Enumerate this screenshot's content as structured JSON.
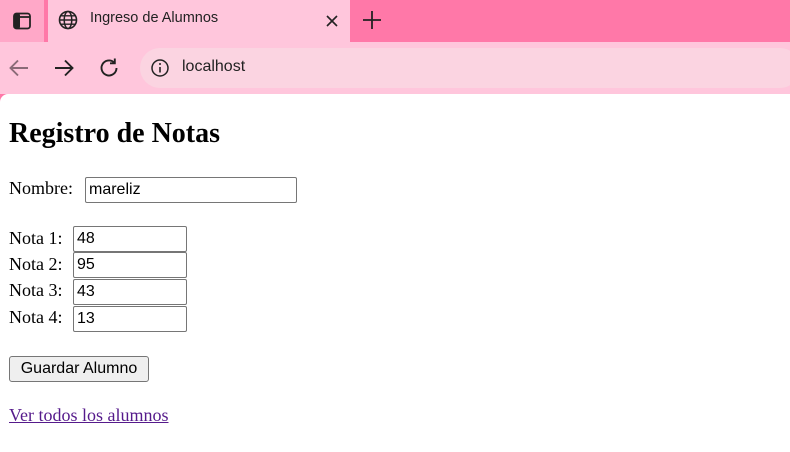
{
  "browser": {
    "tab_title": "Ingreso de Alumnos",
    "url": "localhost",
    "icons": {
      "tab_menu": "tab-menu-icon",
      "favicon": "globe-icon",
      "close": "close-icon",
      "new_tab": "plus-icon",
      "back": "back-arrow-icon",
      "forward": "forward-arrow-icon",
      "reload": "reload-icon",
      "site_info": "info-icon"
    },
    "colors": {
      "titlebar": "#ff78a8",
      "tab": "#ffc6dc",
      "omnibox": "#fbd4e1"
    }
  },
  "page": {
    "heading": "Registro de Notas",
    "nombre_label": "Nombre:",
    "nombre_value": "mareliz",
    "notas": [
      {
        "label": "Nota 1:",
        "value": "48"
      },
      {
        "label": "Nota 2:",
        "value": "95"
      },
      {
        "label": "Nota 3:",
        "value": "43"
      },
      {
        "label": "Nota 4:",
        "value": "13"
      }
    ],
    "save_button": "Guardar Alumno",
    "view_all_link": "Ver todos los alumnos",
    "link_color": "#551a8b"
  }
}
